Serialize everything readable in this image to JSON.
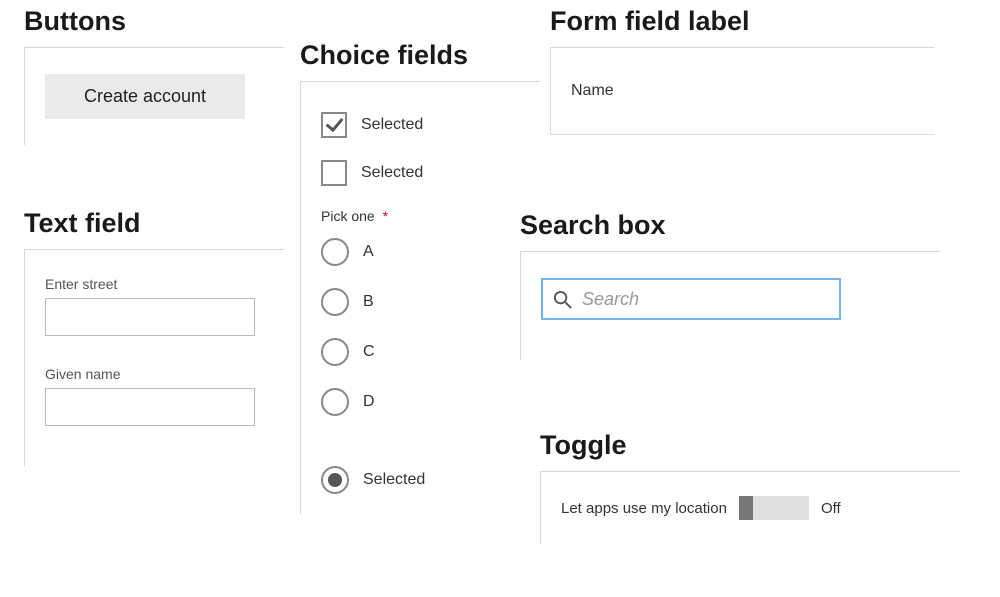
{
  "buttons": {
    "heading": "Buttons",
    "create_account": "Create account"
  },
  "textfield": {
    "heading": "Text field",
    "fields": [
      {
        "label": "Enter street",
        "value": ""
      },
      {
        "label": "Given name",
        "value": ""
      }
    ]
  },
  "choice": {
    "heading": "Choice fields",
    "checkboxes": [
      {
        "label": "Selected",
        "checked": true
      },
      {
        "label": "Selected",
        "checked": false
      }
    ],
    "pick_one_label": "Pick one",
    "pick_one_required": "*",
    "radio_options": [
      {
        "label": "A",
        "selected": false
      },
      {
        "label": "B",
        "selected": false
      },
      {
        "label": "C",
        "selected": false
      },
      {
        "label": "D",
        "selected": false
      }
    ],
    "extra_radio": {
      "label": "Selected",
      "selected": true
    }
  },
  "formlabel": {
    "heading": "Form field label",
    "value": "Name"
  },
  "search": {
    "heading": "Search box",
    "placeholder": "Search"
  },
  "toggle": {
    "heading": "Toggle",
    "label": "Let apps use my location",
    "state_text": "Off",
    "on": false
  }
}
